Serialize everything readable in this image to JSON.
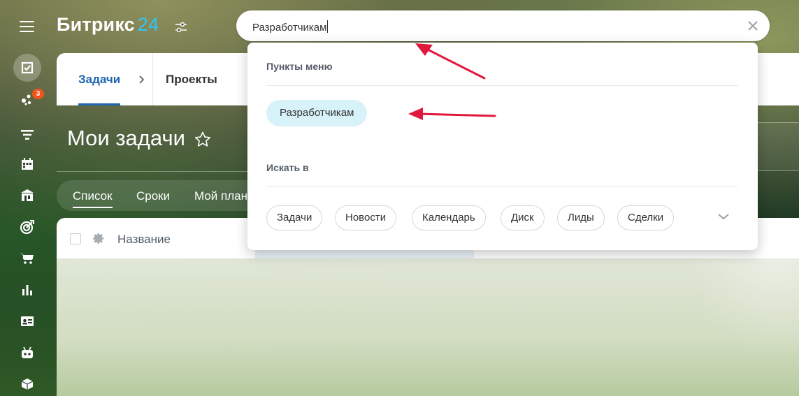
{
  "app": {
    "logo_text": "Битрикс",
    "logo_number": "24"
  },
  "sidebar": {
    "items": [
      {
        "icon": "menu-icon"
      },
      {
        "icon": "tasks-icon",
        "active": true
      },
      {
        "icon": "feed-icon",
        "badge": "3"
      },
      {
        "icon": "filter-icon"
      },
      {
        "icon": "calendar-icon"
      },
      {
        "icon": "bank-icon"
      },
      {
        "icon": "target-icon"
      },
      {
        "icon": "cart-icon"
      },
      {
        "icon": "chart-icon"
      },
      {
        "icon": "contact-card-icon"
      },
      {
        "icon": "robot-icon"
      },
      {
        "icon": "box-icon"
      }
    ]
  },
  "search": {
    "value": "Разработчикам"
  },
  "tabs": {
    "items": [
      "Задачи",
      "Проекты"
    ]
  },
  "page": {
    "title": "Мои задачи"
  },
  "views": {
    "items": [
      "Список",
      "Сроки",
      "Мой план"
    ]
  },
  "grid": {
    "column_name": "Название"
  },
  "dropdown": {
    "menu_section_title": "Пункты меню",
    "result_label": "Разработчикам",
    "search_in_title": "Искать в",
    "chips": [
      "Задачи",
      "Новости",
      "Календарь",
      "Диск",
      "Лиды",
      "Сделки"
    ]
  },
  "colors": {
    "accent": "#2fc6f6",
    "tab_active": "#2066b0",
    "badge": "#f2541b",
    "result_bg": "#d8f2fa",
    "annotation_arrow": "#e0193c"
  }
}
